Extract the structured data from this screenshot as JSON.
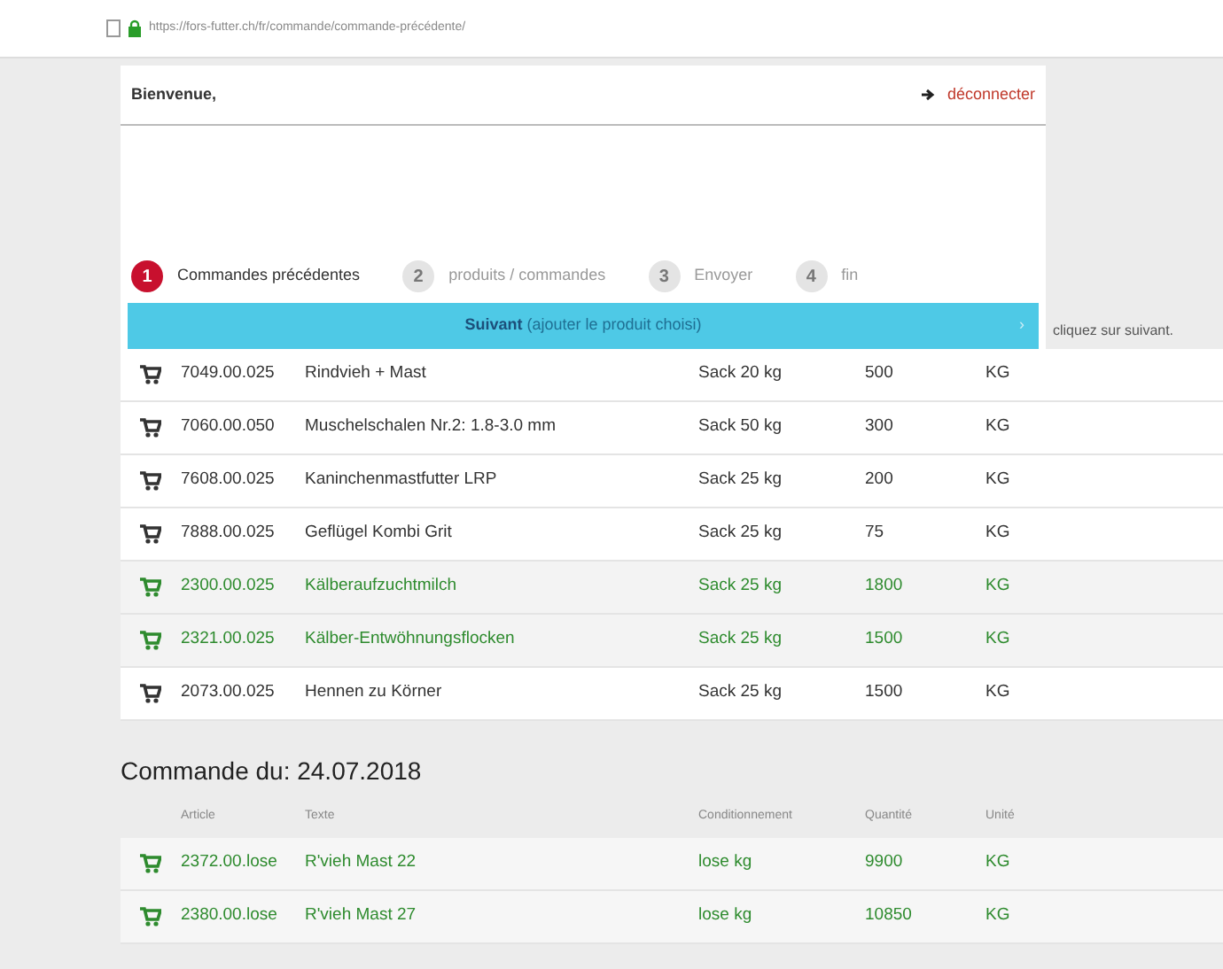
{
  "address_bar": {
    "url": "https://fors-futter.ch/fr/commande/commande-précédente/"
  },
  "header": {
    "greeting": "Bienvenue,",
    "logout": "déconnecter"
  },
  "side_note": "cliquez sur suivant.",
  "steps": [
    {
      "number": "1",
      "label": "Commandes précédentes",
      "selected": true
    },
    {
      "number": "2",
      "label": "produits / commandes",
      "selected": false
    },
    {
      "number": "3",
      "label": "Envoyer",
      "selected": false
    },
    {
      "number": "4",
      "label": "fin",
      "selected": false
    }
  ],
  "next_bar": {
    "label": "Suivant",
    "hint": "(ajouter le produit choisi)",
    "icon": "›"
  },
  "table": {
    "rows": [
      {
        "code": "7049.00.025",
        "name": "Rindvieh + Mast",
        "package": "Sack 20 kg",
        "quantity": "500",
        "unit": "KG",
        "highlighted": false
      },
      {
        "code": "7060.00.050",
        "name": "Muschelschalen Nr.2: 1.8-3.0 mm",
        "package": "Sack 50 kg",
        "quantity": "300",
        "unit": "KG",
        "highlighted": false
      },
      {
        "code": "7608.00.025",
        "name": "Kaninchenmastfutter LRP",
        "package": "Sack 25 kg",
        "quantity": "200",
        "unit": "KG",
        "highlighted": false
      },
      {
        "code": "7888.00.025",
        "name": "Geflügel Kombi Grit",
        "package": "Sack 25 kg",
        "quantity": "75",
        "unit": "KG",
        "highlighted": false
      },
      {
        "code": "2300.00.025",
        "name": "Kälberaufzuchtmilch",
        "package": "Sack 25 kg",
        "quantity": "1800",
        "unit": "KG",
        "highlighted": true
      },
      {
        "code": "2321.00.025",
        "name": "Kälber-Entwöhnungsflocken",
        "package": "Sack 25 kg",
        "quantity": "1500",
        "unit": "KG",
        "highlighted": true
      },
      {
        "code": "2073.00.025",
        "name": "Hennen zu Körner",
        "package": "Sack 25 kg",
        "quantity": "1500",
        "unit": "KG",
        "highlighted": false
      }
    ]
  },
  "order": {
    "title": "Commande du: 24.07.2018",
    "columns": [
      "Article",
      "Texte",
      "Conditionnement",
      "Quantité",
      "Unité"
    ],
    "rows": [
      {
        "code": "2372.00.lose",
        "name": "R'vieh Mast 22",
        "package": "lose kg",
        "quantity": "9900",
        "unit": "KG",
        "highlighted": true
      },
      {
        "code": "2380.00.lose",
        "name": "R'vieh Mast 27",
        "package": "lose kg",
        "quantity": "10850",
        "unit": "KG",
        "highlighted": true
      }
    ]
  }
}
